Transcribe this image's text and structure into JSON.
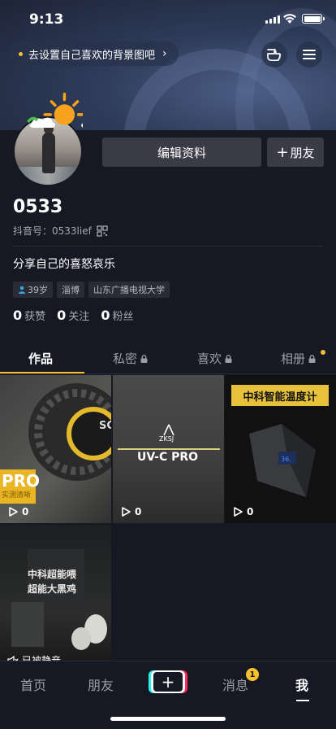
{
  "status_bar": {
    "time": "9:13"
  },
  "cover": {
    "tip": "去设置自己喜欢的背景图吧",
    "tip_chevron": "›"
  },
  "actions": {
    "edit_profile": "编辑资料",
    "add_friend": "朋友",
    "add_friend_prefix": "+"
  },
  "profile": {
    "nickname": "0533",
    "douyin_id": "抖音号：0533lief",
    "signature": "分享自己的喜怒哀乐",
    "tags": [
      "39岁",
      "淄博",
      "山东广播电视大学"
    ],
    "stats": [
      {
        "count": "0",
        "label": "获赞"
      },
      {
        "count": "0",
        "label": "关注"
      },
      {
        "count": "0",
        "label": "粉丝"
      }
    ]
  },
  "tabs": [
    {
      "label": "作品",
      "locked": false
    },
    {
      "label": "私密",
      "locked": true
    },
    {
      "label": "喜欢",
      "locked": true
    },
    {
      "label": "相册",
      "locked": true
    }
  ],
  "grid": [
    {
      "plays": "0",
      "overlay_text": "PRO",
      "sub_text": "实测清晰",
      "side_text": "SC"
    },
    {
      "plays": "0",
      "brand": "ZKSJ",
      "overlay_text": "UV-C PRO"
    },
    {
      "plays": "0",
      "banner": "中科智能温度计"
    },
    {
      "muted_label": "已被静音",
      "line1": "中科超能喂",
      "line2": "超能大黑鸡"
    }
  ],
  "nav": {
    "items": [
      "首页",
      "朋友",
      "消息",
      "我"
    ],
    "plus": "+",
    "message_badge": "1"
  },
  "colors": {
    "accent": "#f5c12e",
    "background": "#161823",
    "button": "#3a3b46",
    "cyan": "#25f4ee",
    "red": "#fe2c55"
  }
}
